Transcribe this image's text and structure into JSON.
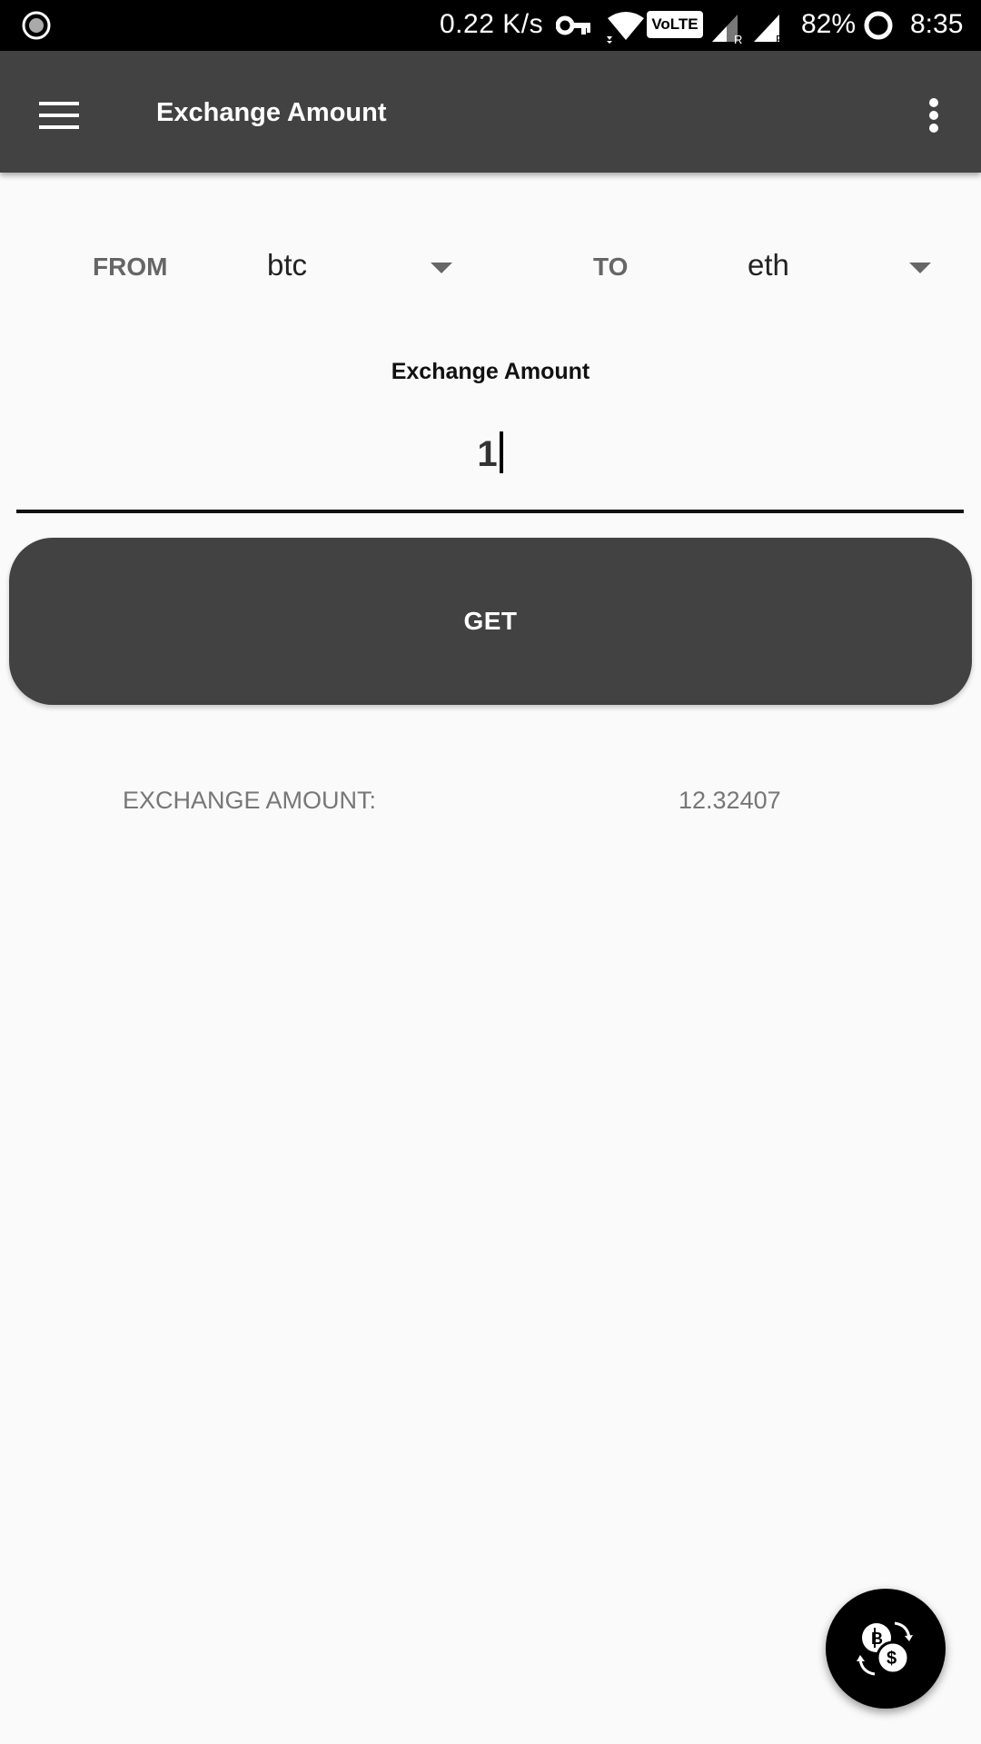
{
  "status_bar": {
    "network_speed": "0.22 K/s",
    "volte_label": "VoLTE",
    "battery_percent": "82%",
    "time": "8:35",
    "icons": [
      "recording-icon",
      "vpn-key-icon",
      "wifi-icon",
      "volte-icon",
      "signal-roaming-icon",
      "signal-roaming-icon",
      "battery-saver-icon"
    ]
  },
  "toolbar": {
    "title": "Exchange Amount",
    "menu_icon": "hamburger-menu-icon",
    "overflow_icon": "more-vert-icon"
  },
  "converter": {
    "from_label": "FROM",
    "from_value": "btc",
    "to_label": "TO",
    "to_value": "eth",
    "amount_caption": "Exchange Amount",
    "amount_value": "1",
    "button_label": "GET",
    "result_label": "EXCHANGE AMOUNT:",
    "result_value": "12.32407"
  },
  "fab": {
    "icon": "currency-exchange-icon"
  },
  "colors": {
    "toolbar": "#424242",
    "button": "#424242",
    "background": "#fafafa",
    "fab": "#000000"
  }
}
